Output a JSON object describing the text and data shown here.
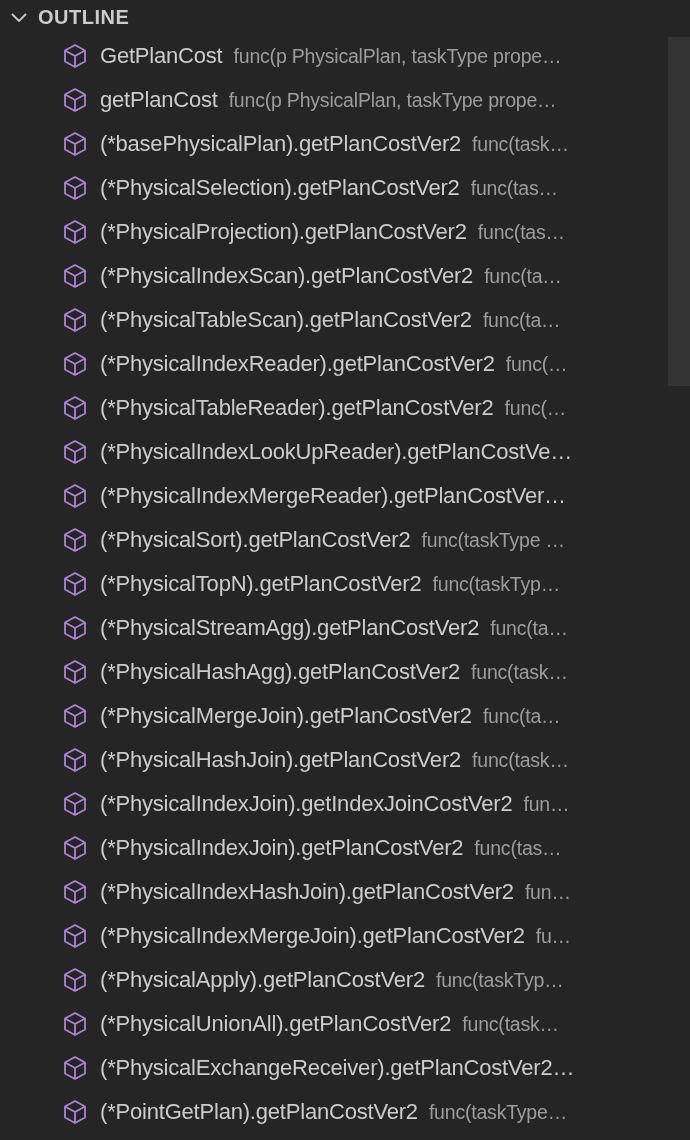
{
  "outline": {
    "title": "OUTLINE",
    "expanded": true,
    "items": [
      {
        "name": "GetPlanCost",
        "detail": "func(p PhysicalPlan, taskType prope…"
      },
      {
        "name": "getPlanCost",
        "detail": "func(p PhysicalPlan, taskType prope…"
      },
      {
        "name": "(*basePhysicalPlan).getPlanCostVer2",
        "detail": "func(task…"
      },
      {
        "name": "(*PhysicalSelection).getPlanCostVer2",
        "detail": "func(tas…"
      },
      {
        "name": "(*PhysicalProjection).getPlanCostVer2",
        "detail": "func(tas…"
      },
      {
        "name": "(*PhysicalIndexScan).getPlanCostVer2",
        "detail": "func(ta…"
      },
      {
        "name": "(*PhysicalTableScan).getPlanCostVer2",
        "detail": "func(ta…"
      },
      {
        "name": "(*PhysicalIndexReader).getPlanCostVer2",
        "detail": "func(…"
      },
      {
        "name": "(*PhysicalTableReader).getPlanCostVer2",
        "detail": "func(…"
      },
      {
        "name": "(*PhysicalIndexLookUpReader).getPlanCostVe…"
      },
      {
        "name": "(*PhysicalIndexMergeReader).getPlanCostVer…"
      },
      {
        "name": "(*PhysicalSort).getPlanCostVer2",
        "detail": "func(taskType …"
      },
      {
        "name": "(*PhysicalTopN).getPlanCostVer2",
        "detail": "func(taskTyp…"
      },
      {
        "name": "(*PhysicalStreamAgg).getPlanCostVer2",
        "detail": "func(ta…"
      },
      {
        "name": "(*PhysicalHashAgg).getPlanCostVer2",
        "detail": "func(task…"
      },
      {
        "name": "(*PhysicalMergeJoin).getPlanCostVer2",
        "detail": "func(ta…"
      },
      {
        "name": "(*PhysicalHashJoin).getPlanCostVer2",
        "detail": "func(task…"
      },
      {
        "name": "(*PhysicalIndexJoin).getIndexJoinCostVer2",
        "detail": "fun…"
      },
      {
        "name": "(*PhysicalIndexJoin).getPlanCostVer2",
        "detail": "func(tas…"
      },
      {
        "name": "(*PhysicalIndexHashJoin).getPlanCostVer2",
        "detail": "fun…"
      },
      {
        "name": "(*PhysicalIndexMergeJoin).getPlanCostVer2",
        "detail": "fu…"
      },
      {
        "name": "(*PhysicalApply).getPlanCostVer2",
        "detail": "func(taskTyp…"
      },
      {
        "name": "(*PhysicalUnionAll).getPlanCostVer2",
        "detail": "func(task…"
      },
      {
        "name": "(*PhysicalExchangeReceiver).getPlanCostVer2…"
      },
      {
        "name": "(*PointGetPlan).getPlanCostVer2",
        "detail": "func(taskType…"
      }
    ]
  }
}
